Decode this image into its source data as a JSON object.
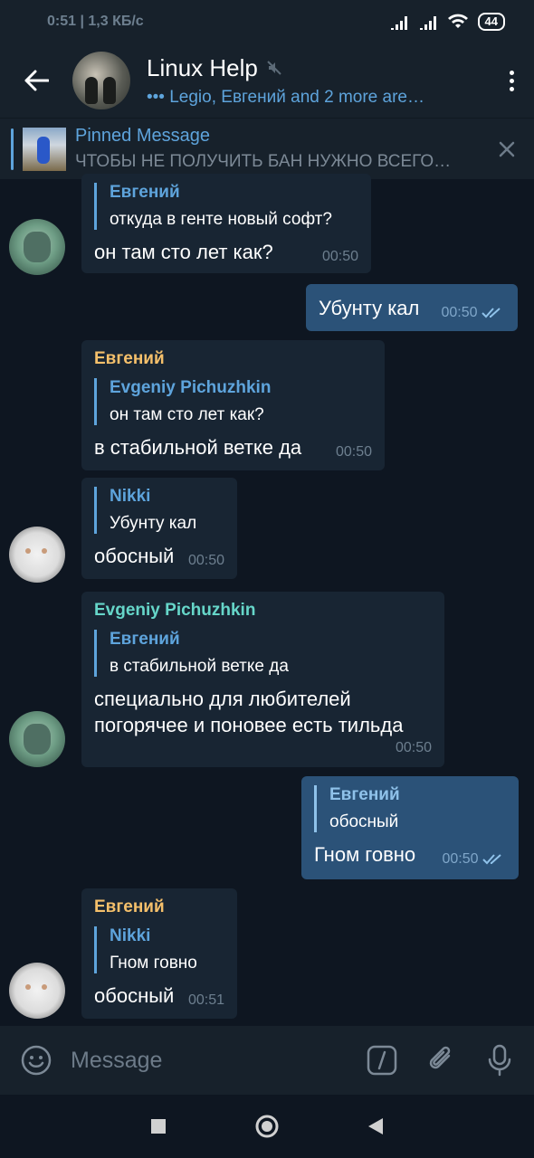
{
  "status_bar": {
    "time": "0:51",
    "speed": "| 1,3 КБ/с",
    "battery": "44"
  },
  "header": {
    "title": "Linux Help",
    "subtitle": "••• Legio, Евгений and 2 more are…"
  },
  "pinned": {
    "title": "Pinned Message",
    "text": "ЧТОБЫ НЕ ПОЛУЧИТЬ БАН НУЖНО ВСЕГО…"
  },
  "messages": [
    {
      "direction": "in",
      "reply_name": "Евгений",
      "reply_text": "откуда в генте новый софт?",
      "text": "он там сто лет как?",
      "time": "00:50",
      "avatar": "green-robot-avatar"
    },
    {
      "direction": "out",
      "text": "Убунту кал",
      "time": "00:50",
      "status": "read"
    },
    {
      "direction": "in",
      "sender": "Евгений",
      "sender_color": "#f5c06b",
      "reply_name": "Evgeniy Pichuzhkin",
      "reply_text": "он там сто лет как?",
      "text": "в стабильной ветке да",
      "time": "00:50"
    },
    {
      "direction": "in",
      "reply_name": "Nikki",
      "reply_text": "Убунту кал",
      "text": "обосный",
      "time": "00:50",
      "avatar": "cat-avatar"
    },
    {
      "direction": "in",
      "sender": "Evgeniy Pichuzhkin",
      "sender_color": "#66d6c9",
      "reply_name": "Евгений",
      "reply_text": "в стабильной ветке да",
      "text_line1": "специально для любителей",
      "text_line2": "погорячее и поновее есть тильда",
      "time": "00:50",
      "avatar": "green-robot-avatar"
    },
    {
      "direction": "out",
      "reply_name": "Евгений",
      "reply_text": "обосный",
      "text": "Гном говно",
      "time": "00:50",
      "status": "read"
    },
    {
      "direction": "in",
      "sender": "Евгений",
      "sender_color": "#f5c06b",
      "reply_name": "Nikki",
      "reply_text": "Гном говно",
      "text": "обосный",
      "time": "00:51",
      "avatar": "cat-avatar"
    }
  ],
  "input": {
    "placeholder": "Message"
  },
  "colors": {
    "background": "#0e1621",
    "panel": "#17212b",
    "incoming_bubble": "#182533",
    "outgoing_bubble": "#2b5278",
    "accent": "#5ea4dc"
  }
}
